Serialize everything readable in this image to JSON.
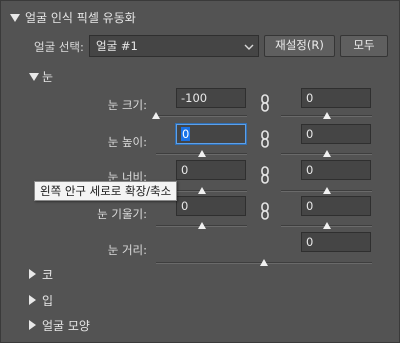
{
  "panel": {
    "title": "얼굴 인식 픽셀 유동화"
  },
  "face_select": {
    "label": "얼굴 선택:",
    "value": "얼굴 #1",
    "reset_button": "재설정(R)",
    "all_button": "모두"
  },
  "eyes": {
    "title": "눈",
    "rows": [
      {
        "label": "눈 크기:",
        "left": "-100",
        "right": "0",
        "left_level": 0.0,
        "right_level": 0.5
      },
      {
        "label": "눈 높이:",
        "left": "0",
        "right": "0",
        "left_level": 0.5,
        "right_level": 0.5
      },
      {
        "label": "눈 너비:",
        "left": "0",
        "right": "0",
        "left_level": 0.5,
        "right_level": 0.5
      },
      {
        "label": "눈 기울기:",
        "left": "0",
        "right": "0",
        "left_level": 0.5,
        "right_level": 0.5
      }
    ],
    "distance": {
      "label": "눈 거리:",
      "value": "0",
      "level": 0.5
    }
  },
  "tooltip": "왼쪽 안구 세로로 확장/축소",
  "sections": {
    "nose": "코",
    "mouth": "입",
    "face_shape": "얼굴 모양"
  },
  "icons": {
    "link": "link-chain-icon",
    "expand": "triangle-down-icon",
    "collapse": "triangle-right-icon",
    "dropdown": "chevron-down-icon"
  }
}
